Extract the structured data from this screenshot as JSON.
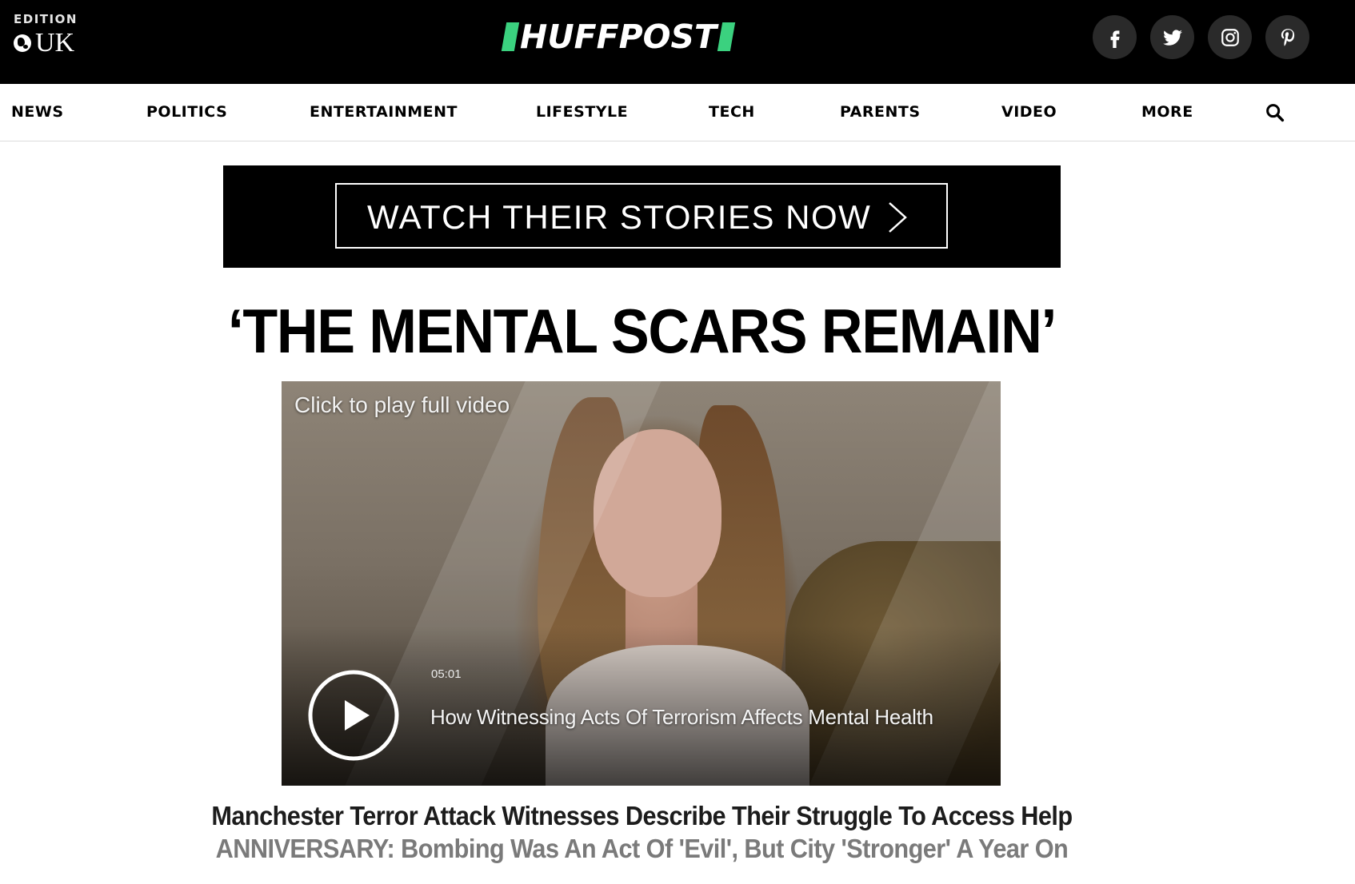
{
  "header": {
    "edition_label": "EDITION",
    "edition_name": "UK",
    "logo_text": "HUFFPOST",
    "logo_accent_color": "#3bd17f",
    "socials": [
      "facebook-icon",
      "twitter-icon",
      "instagram-icon",
      "pinterest-icon"
    ]
  },
  "nav": {
    "items": [
      "NEWS",
      "POLITICS",
      "ENTERTAINMENT",
      "LIFESTYLE",
      "TECH",
      "PARENTS",
      "VIDEO",
      "MORE"
    ],
    "search_icon": "search-icon"
  },
  "banner": {
    "label": "WATCH THEIR STORIES NOW"
  },
  "main": {
    "headline": "‘THE MENTAL SCARS REMAIN’",
    "video": {
      "caption": "Click to play full video",
      "duration": "05:01",
      "title": "How Witnessing Acts Of Terrorism Affects Mental Health"
    },
    "story_title": "Manchester Terror Attack Witnesses Describe Their Struggle To Access Help",
    "story_sub": "ANNIVERSARY: Bombing Was An Act Of 'Evil', But City 'Stronger' A Year On"
  }
}
